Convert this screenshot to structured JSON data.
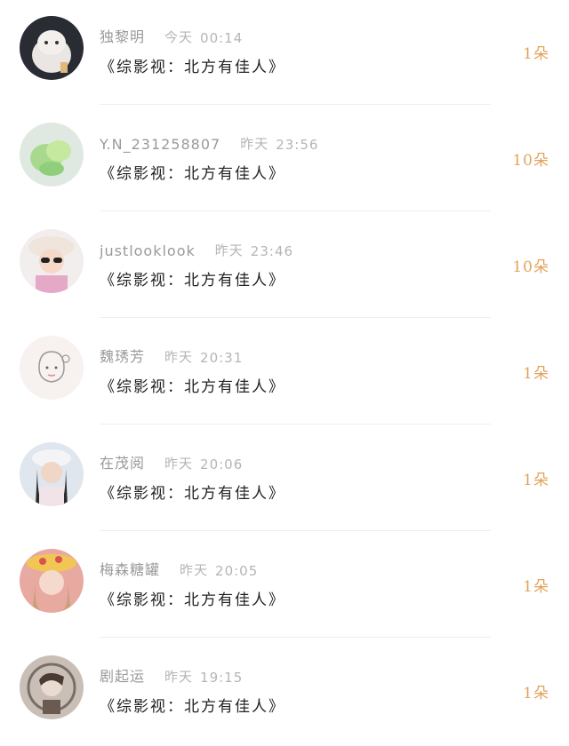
{
  "items": [
    {
      "name": "独黎明",
      "time_label": "今天",
      "time": "00:14",
      "title": "《综影视：北方有佳人》",
      "count": "1朵",
      "avatar_icon": "persian-cat-avatar"
    },
    {
      "name": "Y.N_231258807",
      "time_label": "昨天",
      "time": "23:56",
      "title": "《综影视：北方有佳人》",
      "count": "10朵",
      "avatar_icon": "green-plant-avatar"
    },
    {
      "name": "justlooklook",
      "time_label": "昨天",
      "time": "23:46",
      "title": "《综影视：北方有佳人》",
      "count": "10朵",
      "avatar_icon": "girl-hat-sunglasses-avatar"
    },
    {
      "name": "魏琇芳",
      "time_label": "昨天",
      "time": "20:31",
      "title": "《综影视：北方有佳人》",
      "count": "1朵",
      "avatar_icon": "sketch-girl-avatar"
    },
    {
      "name": "在茂阅",
      "time_label": "昨天",
      "time": "20:06",
      "title": "《综影视：北方有佳人》",
      "count": "1朵",
      "avatar_icon": "woman-white-cap-avatar"
    },
    {
      "name": "梅森糖罐",
      "time_label": "昨天",
      "time": "20:05",
      "title": "《综影视：北方有佳人》",
      "count": "1朵",
      "avatar_icon": "girl-flower-hat-avatar"
    },
    {
      "name": "剧起运",
      "time_label": "昨天",
      "time": "19:15",
      "title": "《综影视：北方有佳人》",
      "count": "1朵",
      "avatar_icon": "anime-character-avatar"
    }
  ],
  "colors": {
    "count_accent": "#e3a25b",
    "name_gray": "#9a9a9a",
    "divider": "#efefef"
  }
}
